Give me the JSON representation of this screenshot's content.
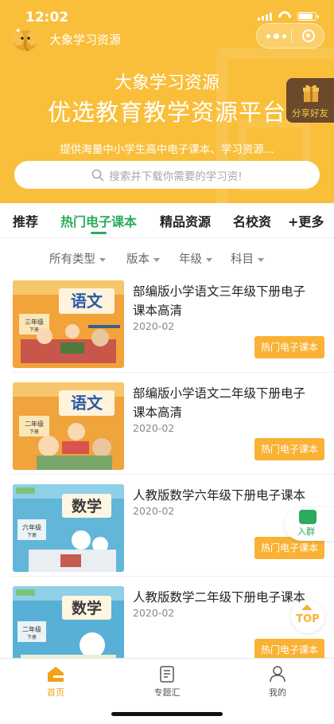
{
  "status_bar": {
    "time": "12:02"
  },
  "nav": {
    "app_name": "大象学习资源"
  },
  "hero": {
    "title": "大象学习资源",
    "subtitle": "优选教育教学资源平台",
    "description": "提供海量中小学生高中电子课本、学习资源...",
    "search_placeholder": "搜索并下载你需要的学习资!"
  },
  "share_badge": {
    "label": "分享好友"
  },
  "tabs": [
    {
      "label": "推荐",
      "active": false
    },
    {
      "label": "热门电子课本",
      "active": true
    },
    {
      "label": "精品资源",
      "active": false
    },
    {
      "label": "名校资",
      "active": false
    }
  ],
  "more_tab": {
    "label": "+更多"
  },
  "filters": [
    {
      "label": "所有类型"
    },
    {
      "label": "版本"
    },
    {
      "label": "年级"
    },
    {
      "label": "科目"
    }
  ],
  "list": [
    {
      "title": "部编版小学语文三年级下册电子课本高清",
      "date": "2020-02",
      "tag": "热门电子课本",
      "cover": {
        "subject": "语文",
        "grade": "三年级",
        "volume": "下册",
        "color": "#f2a33a"
      }
    },
    {
      "title": "部编版小学语文二年级下册电子课本高清",
      "date": "2020-02",
      "tag": "热门电子课本",
      "cover": {
        "subject": "语文",
        "grade": "二年级",
        "volume": "下册",
        "color": "#f0a43c"
      }
    },
    {
      "title": "人教版数学六年级下册电子课本",
      "date": "2020-02",
      "tag": "热门电子课本",
      "cover": {
        "subject": "数学",
        "grade": "六年级",
        "volume": "下册",
        "color": "#62b6d8"
      }
    },
    {
      "title": "人教版数学二年级下册电子课本",
      "date": "2020-02",
      "tag": "热门电子课本",
      "cover": {
        "subject": "数学",
        "grade": "二年级",
        "volume": "下册",
        "color": "#59b0d6"
      }
    }
  ],
  "float_group": {
    "label": "入群"
  },
  "float_top": {
    "label": "TOP"
  },
  "bottom_nav": [
    {
      "label": "首页",
      "icon": "home-icon",
      "active": true
    },
    {
      "label": "专题汇",
      "icon": "document-icon",
      "active": false
    },
    {
      "label": "我的",
      "icon": "user-icon",
      "active": false
    }
  ],
  "colors": {
    "brand": "#f9bf3b",
    "accent_green": "#2bab5b",
    "tag_orange": "#f9b234"
  }
}
